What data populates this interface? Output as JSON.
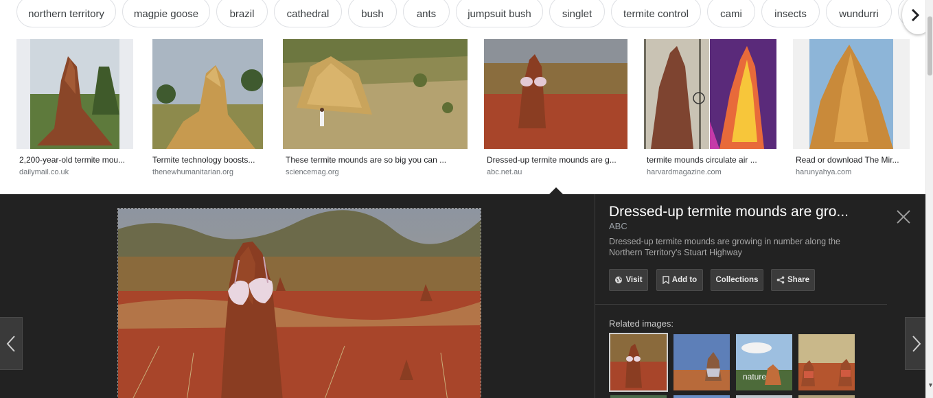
{
  "chips": [
    "northern territory",
    "magpie goose",
    "brazil",
    "cathedral",
    "bush",
    "ants",
    "jumpsuit bush",
    "singlet",
    "termite control",
    "cami",
    "insects",
    "wundurri"
  ],
  "results": [
    {
      "title": "2,200-year-old termite mou...",
      "source": "dailymail.co.uk"
    },
    {
      "title": "Termite technology boosts...",
      "source": "thenewhumanitarian.org"
    },
    {
      "title": "These termite mounds are so big you can ...",
      "source": "sciencemag.org"
    },
    {
      "title": "Dressed-up termite mounds are g...",
      "source": "abc.net.au"
    },
    {
      "title": "termite mounds circulate air ...",
      "source": "harvardmagazine.com"
    },
    {
      "title": "Read or download The Mir...",
      "source": "harunyahya.com"
    }
  ],
  "preview": {
    "title": "Dressed-up termite mounds are gro...",
    "source": "ABC",
    "description": "Dressed-up termite mounds are growing in number along the Northern Territory's Stuart Highway",
    "buttons": {
      "visit": "Visit",
      "add_to": "Add to",
      "collections": "Collections",
      "share": "Share"
    },
    "related_label": "Related images:",
    "related_watermark": "nature"
  },
  "icons": [
    "chevron-right-icon",
    "chevron-left-icon",
    "close-icon",
    "globe-icon",
    "bookmark-icon",
    "share-icon"
  ],
  "colors": {
    "panel_bg": "#222222",
    "chip_border": "#dfe1e5",
    "soil": "#a8452a",
    "mound": "#8a3d22"
  }
}
